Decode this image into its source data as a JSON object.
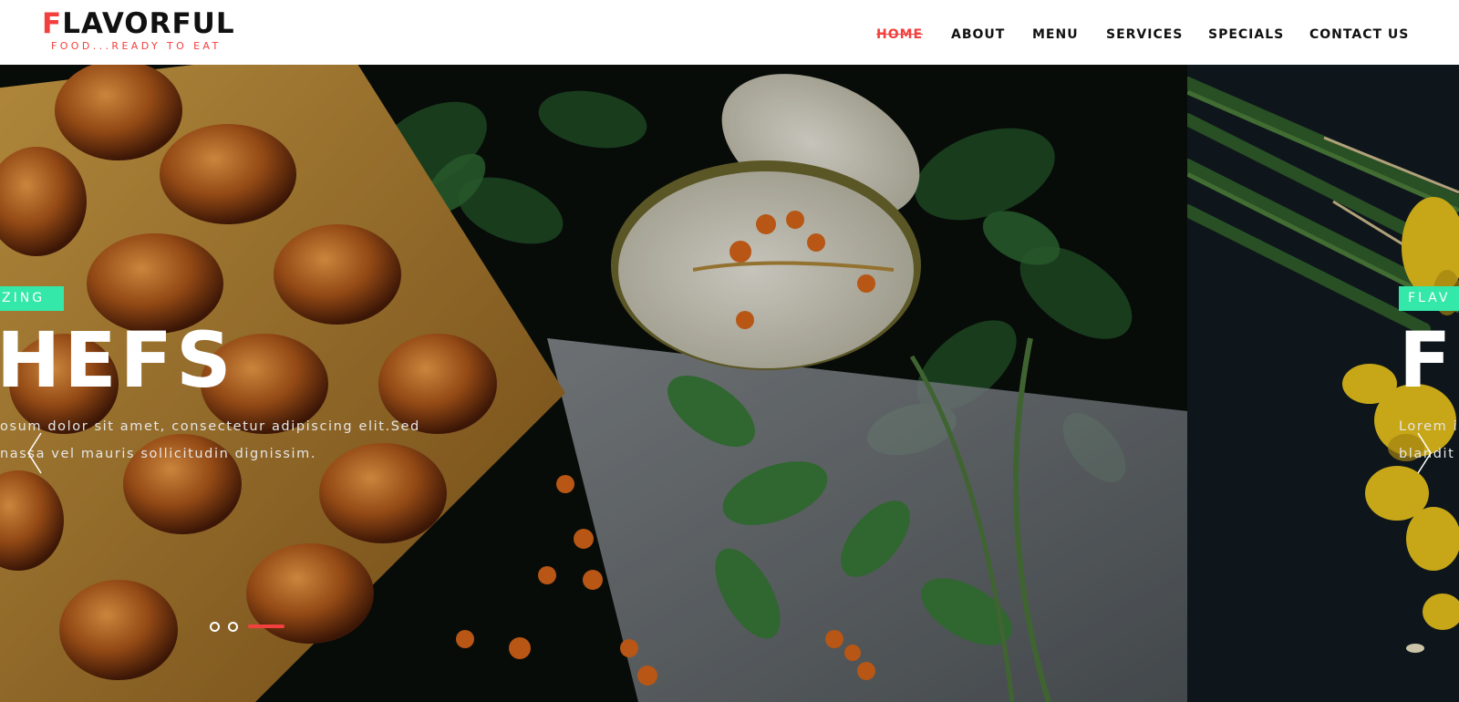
{
  "brand": {
    "first_letter": "F",
    "rest": "LAVORFUL",
    "tagline": "FOOD...READY TO EAT",
    "accent_color": "#f2403e"
  },
  "nav": {
    "items": [
      "HOME",
      "ABOUT",
      "MENU",
      "SERVICES",
      "SPECIALS",
      "CONTACT US"
    ],
    "active": "HOME"
  },
  "slides": [
    {
      "badge": "ZING",
      "headline": "HEFS",
      "text_line_1": "osum dolor sit amet, consectetur adipiscing elit.Sed",
      "text_line_2": "nassa vel mauris sollicitudin dignissim."
    },
    {
      "badge": "FLAV",
      "headline": "F",
      "text_line_1": "Lorem i",
      "text_line_2": "blandit"
    }
  ],
  "carousel": {
    "prev_icon": "chevron-left-icon",
    "next_icon": "chevron-right-icon",
    "dot_count": 3,
    "active_dot": 3,
    "badge_color": "#34e8a9"
  }
}
